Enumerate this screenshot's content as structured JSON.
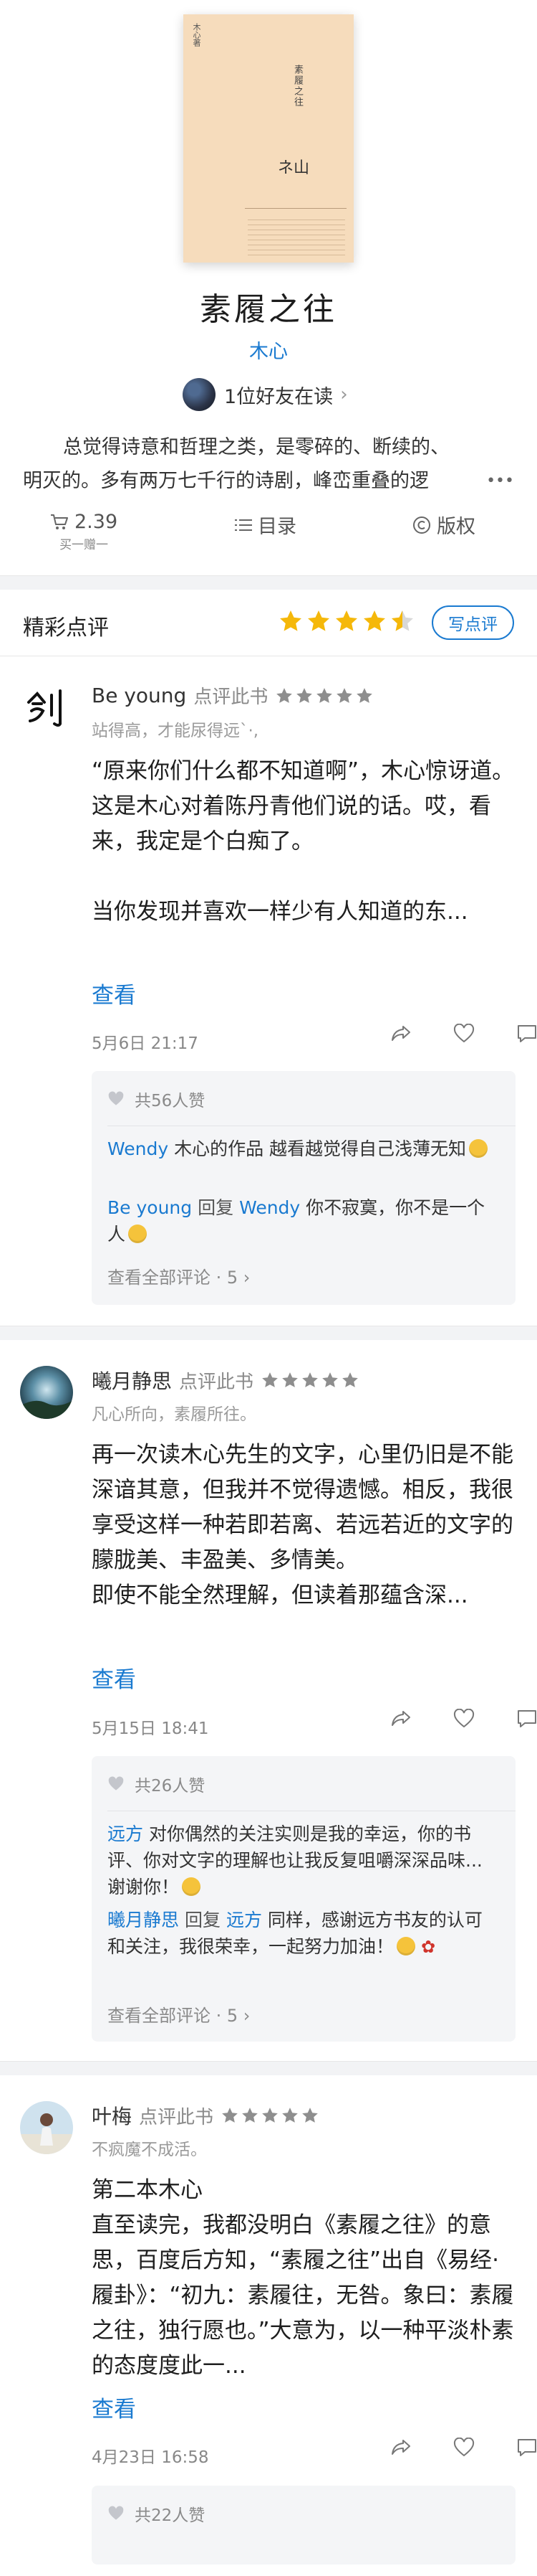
{
  "book": {
    "cover": {
      "author_vertical": "木心著",
      "title_vertical": "素履之往",
      "mark": "ネ山"
    },
    "title": "素履之往",
    "author": "木心",
    "friends_reading": "1位好友在读",
    "intro_line1": "总觉得诗意和哲理之类，是零碎的、断续的、",
    "intro_line2": "明灭的。多有两万七千行的诗剧，峰峦重叠的逻",
    "more_icon": "more-dots-icon",
    "price": "2.39",
    "price_sub": "买一赠一",
    "toc_label": "目录",
    "copyright_label": "版权"
  },
  "section": {
    "title": "精彩点评",
    "rating_stars": 4.5,
    "write_button": "写点评"
  },
  "colors": {
    "accent": "#1a7ad0",
    "star": "#f5b80a"
  },
  "reviews": [
    {
      "name": "Be young",
      "action": "点评此书",
      "stars": 5,
      "signature": "站得高，才能尿得远`·,",
      "body": [
        "“原来你们什么都不知道啊”，木心惊讶道。",
        "这是木心对着陈丹青他们说的话。哎，看来，我定是个白痴了。",
        "",
        "当你发现并喜欢一样少有人知道的东..."
      ],
      "more": "查看",
      "time": "5月6日 21:17",
      "likes": "共56人赞",
      "comments": [
        {
          "who": "Wendy",
          "text": "木心的作品 越看越觉得自己浅薄无知"
        },
        {
          "who": "Be young",
          "reply_word": "回复",
          "to": "Wendy",
          "text": "你不寂寞，你不是一个人"
        }
      ],
      "view_all": "查看全部评论 · 5"
    },
    {
      "name": "曦月静思",
      "action": "点评此书",
      "stars": 5,
      "signature": "凡心所向，素履所往。",
      "body": [
        "再一次读木心先生的文字，心里仍旧是不能深谙其意，但我并不觉得遗憾。相反，我很享受这样一种若即若离、若远若近的文字的朦胧美、丰盈美、多情美。",
        "即使不能全然理解，但读着那蕴含深..."
      ],
      "more": "查看",
      "time": "5月15日 18:41",
      "likes": "共26人赞",
      "comments": [
        {
          "who": "远方",
          "text": "对你偶然的关注实则是我的幸运，你的书评、你对文字的理解也让我反复咀嚼深深品味...谢谢你！"
        },
        {
          "who": "曦月静思",
          "reply_word": "回复",
          "to": "远方",
          "text": "同样，感谢远方书友的认可和关注，我很荣幸，一起努力加油！"
        }
      ],
      "view_all": "查看全部评论 · 5"
    },
    {
      "name": "叶梅",
      "action": "点评此书",
      "stars": 5,
      "signature": "不疯魔不成活。",
      "body": [
        "第二本木心",
        "直至读完，我都没明白《素履之往》的意思，百度后方知，“素履之往”出自《易经·履卦》：“初九：素履往，无咎。象曰：素履之往，独行愿也。”大意为，以一种平淡朴素的态度度此一..."
      ],
      "more": "查看",
      "time": "4月23日 16:58",
      "likes": "共22人赞"
    }
  ]
}
